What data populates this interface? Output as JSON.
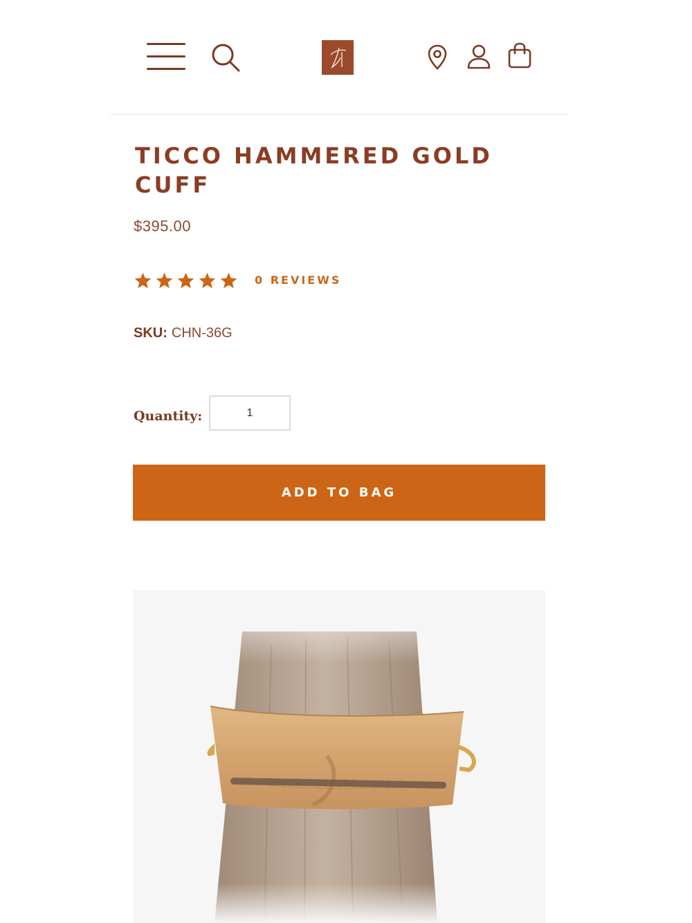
{
  "header": {
    "menu_icon": "hamburger-menu-icon",
    "search_icon": "search-icon",
    "logo_icon": "brand-logo",
    "location_icon": "map-pin-icon",
    "account_icon": "user-icon",
    "bag_icon": "shopping-bag-icon"
  },
  "product": {
    "title": "TICCO HAMMERED GOLD CUFF",
    "price": "$395.00",
    "rating": {
      "stars": 5,
      "max": 5
    },
    "reviews_link": "0 REVIEWS",
    "sku_label": "SKU:",
    "sku_value": "CHN-36G",
    "quantity_label": "Quantity:",
    "quantity_value": "1",
    "add_to_bag_label": "ADD TO BAG",
    "image_alt": "Hammered gold cuff with beaded strand on wooden display"
  },
  "colors": {
    "brand_brown": "#8b3d24",
    "accent_orange": "#cc6616",
    "logo_bg": "#9b4a2b"
  }
}
